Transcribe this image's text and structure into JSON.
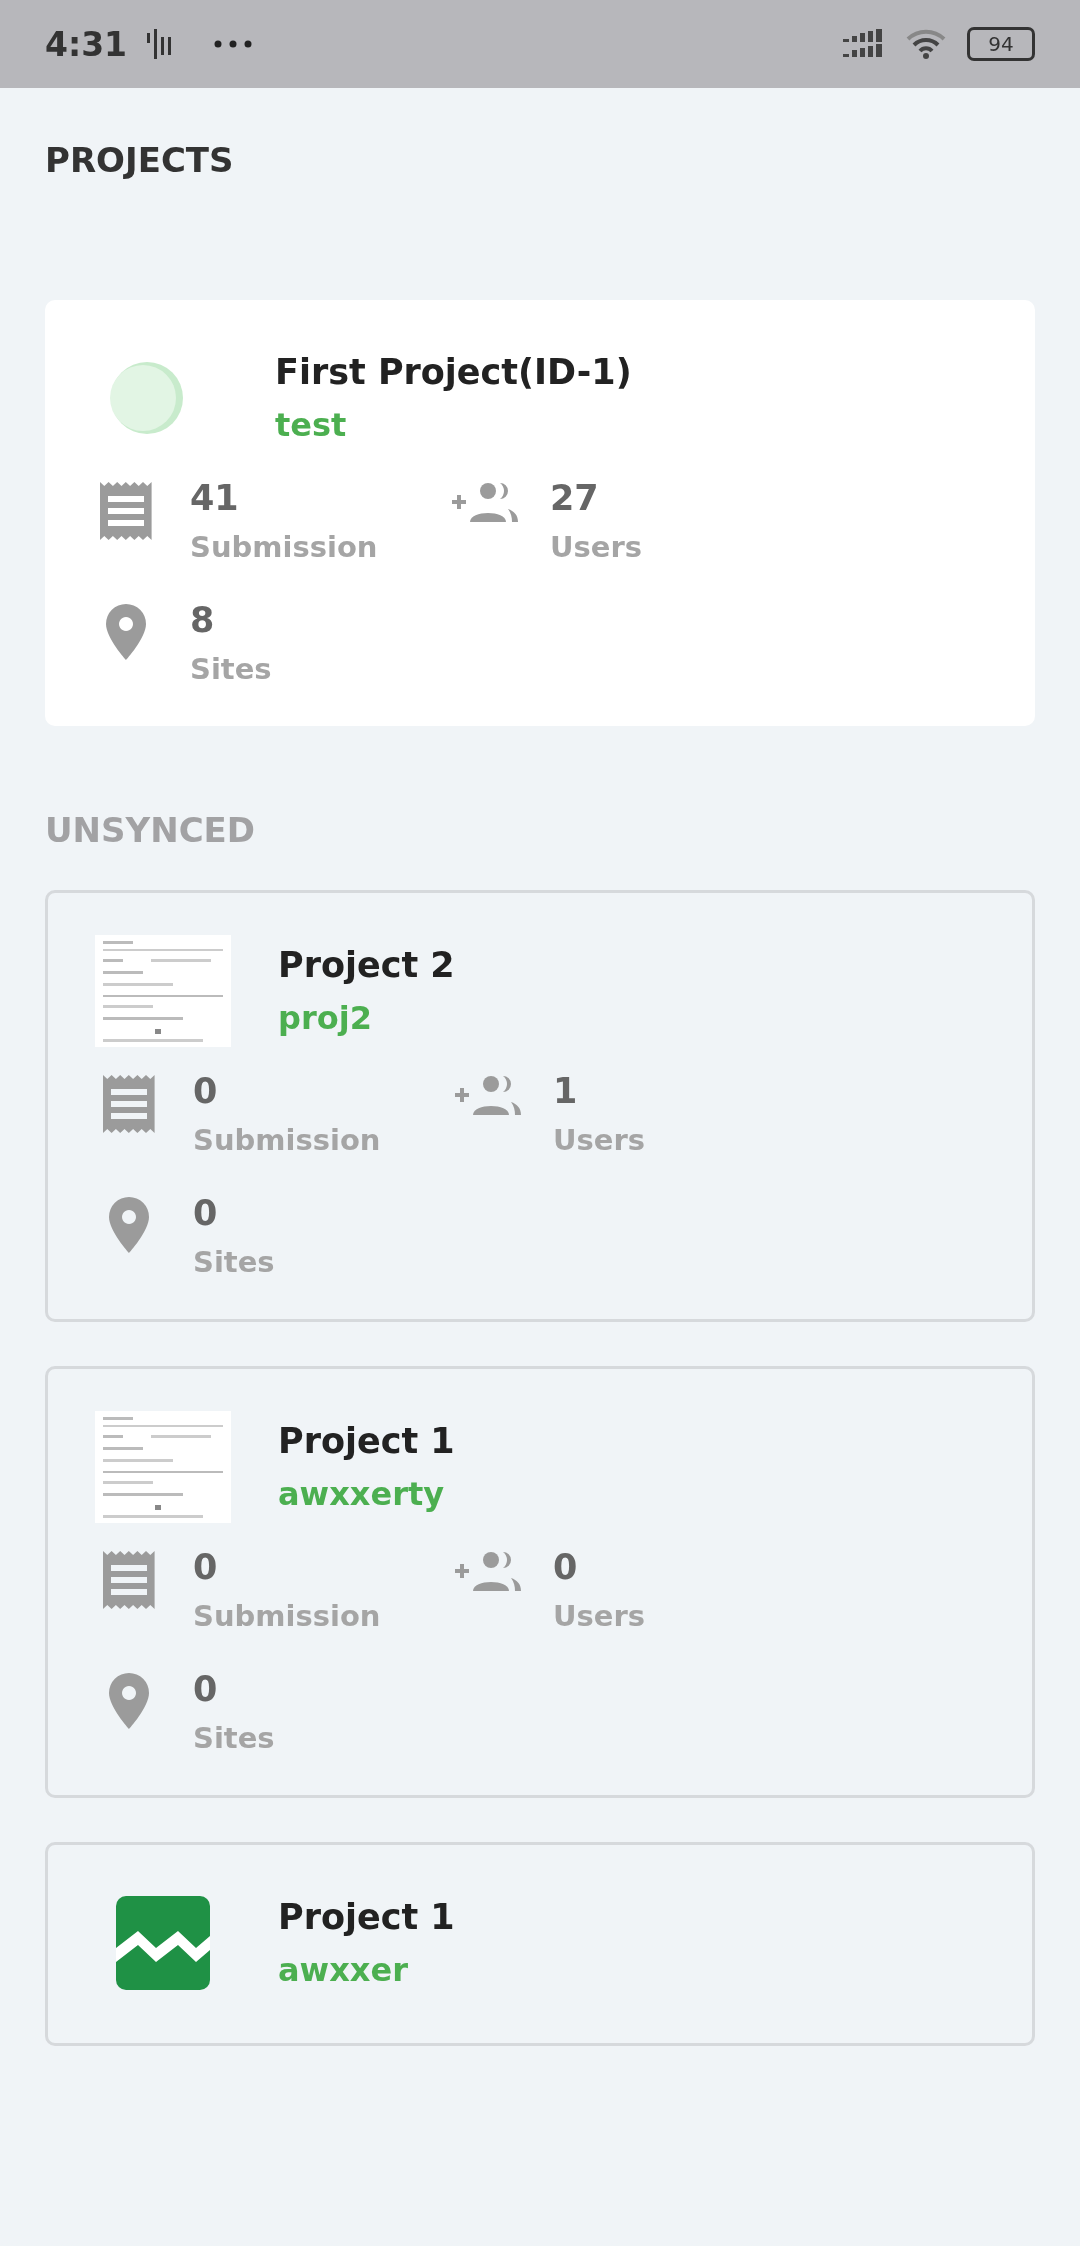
{
  "status_bar": {
    "time": "4:31",
    "battery": "94"
  },
  "heading": "PROJECTS",
  "sections": [
    {
      "cards": [
        {
          "synced": true,
          "thumbnail": {
            "kind": "logo"
          },
          "title": "First Project(ID-1)",
          "subtitle": "test",
          "stats": [
            {
              "kind": "submission",
              "value": "41",
              "label": "Submission"
            },
            {
              "kind": "users",
              "value": "27",
              "label": "Users"
            },
            {
              "kind": "sites",
              "value": "8",
              "label": "Sites"
            }
          ]
        }
      ]
    },
    {
      "title": "UNSYNCED",
      "cards": [
        {
          "synced": false,
          "title": "Project 2",
          "subtitle": "proj2",
          "stats": [
            {
              "kind": "submission",
              "value": "0",
              "label": "Submission"
            },
            {
              "kind": "users",
              "value": "1",
              "label": "Users"
            },
            {
              "kind": "sites",
              "value": "0",
              "label": "Sites"
            }
          ]
        },
        {
          "synced": false,
          "title": "Project 1",
          "subtitle": "awxxerty",
          "stats": [
            {
              "kind": "submission",
              "value": "0",
              "label": "Submission"
            },
            {
              "kind": "users",
              "value": "0",
              "label": "Users"
            },
            {
              "kind": "sites",
              "value": "0",
              "label": "Sites"
            }
          ]
        },
        {
          "synced": false,
          "thumbnail": {
            "kind": "chart"
          },
          "title": "Project 1",
          "subtitle": "awxxer"
        }
      ]
    }
  ]
}
